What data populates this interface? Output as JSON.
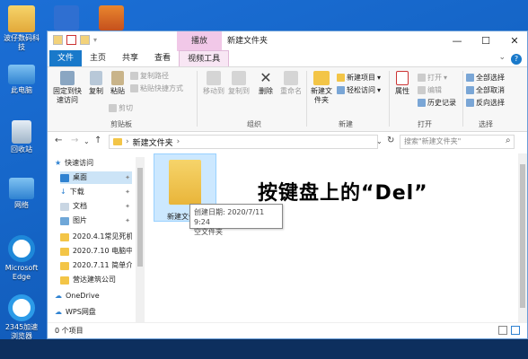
{
  "desktop": {
    "icons": [
      {
        "label": "波仔数码科技",
        "icon": "user-folder-icon"
      },
      {
        "label": "此电脑",
        "icon": "computer-icon"
      },
      {
        "label": "回收站",
        "icon": "recycle-bin-icon"
      },
      {
        "label": "网络",
        "icon": "network-icon"
      },
      {
        "label": "Microsoft Edge",
        "icon": "edge-icon"
      },
      {
        "label": "2345加速浏览器",
        "icon": "browser-icon"
      }
    ]
  },
  "window": {
    "title": "新建文件夹",
    "context_tab": "播放",
    "controls": {
      "minimize": "—",
      "maximize": "☐",
      "close": "✕"
    }
  },
  "tabs": [
    "文件",
    "主页",
    "共享",
    "查看",
    "视频工具"
  ],
  "ribbon": {
    "clipboard": {
      "group": "剪贴板",
      "pin": "固定到快速访问",
      "copy": "复制",
      "paste": "粘贴",
      "copy_path": "复制路径",
      "paste_shortcut": "粘贴快捷方式",
      "cut": "剪切"
    },
    "organize": {
      "group": "组织",
      "move_to": "移动到",
      "copy_to": "复制到",
      "delete": "删除",
      "rename": "重命名"
    },
    "new": {
      "group": "新建",
      "new_folder": "新建文件夹",
      "new_item": "新建项目",
      "easy_access": "轻松访问"
    },
    "open": {
      "group": "打开",
      "properties": "属性",
      "open": "打开",
      "edit": "编辑",
      "history": "历史记录"
    },
    "select": {
      "group": "选择",
      "select_all": "全部选择",
      "select_none": "全部取消",
      "invert": "反向选择"
    }
  },
  "address": {
    "back": "←",
    "forward": "→",
    "up": "↑",
    "path": "新建文件夹",
    "refresh": "↻",
    "search_placeholder": "搜索\"新建文件夹\""
  },
  "sidebar": {
    "items": [
      {
        "label": "快速访问",
        "icon": "star-icon"
      },
      {
        "label": "桌面",
        "icon": "desktop-icon",
        "pinned": true
      },
      {
        "label": "下载",
        "icon": "download-icon",
        "pinned": true
      },
      {
        "label": "文档",
        "icon": "document-icon",
        "pinned": true
      },
      {
        "label": "图片",
        "icon": "picture-icon",
        "pinned": true
      },
      {
        "label": "2020.4.1常见死机",
        "icon": "folder-icon"
      },
      {
        "label": "2020.7.10 电脑中",
        "icon": "folder-icon"
      },
      {
        "label": "2020.7.11 简单介",
        "icon": "folder-icon"
      },
      {
        "label": "营达建筑公司",
        "icon": "folder-icon"
      },
      {
        "label": "OneDrive",
        "icon": "cloud-icon"
      },
      {
        "label": "WPS网盘",
        "icon": "wps-cloud-icon"
      }
    ]
  },
  "content": {
    "file_name": "新建文件夹",
    "tooltip_line1": "创建日期: 2020/7/11 9:24",
    "tooltip_line2": "空文件夹",
    "overlay_text": "按键盘上的“Del”"
  },
  "status": {
    "item_count": "0 个项目"
  },
  "colors": {
    "accent": "#1979ca",
    "desktop": "#1565c7",
    "folder": "#f3c547"
  }
}
